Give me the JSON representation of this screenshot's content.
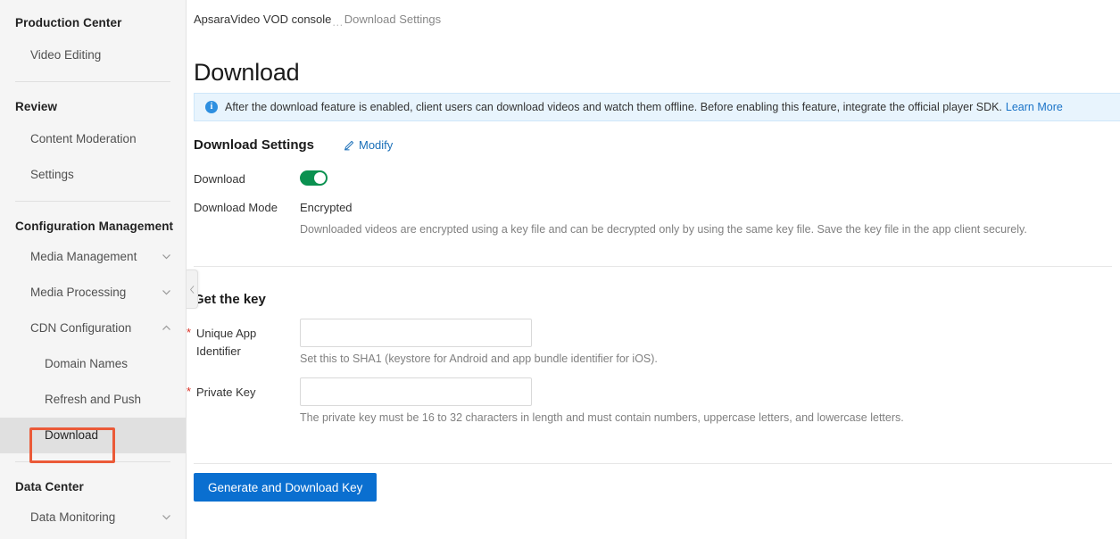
{
  "sidebar": {
    "groups": [
      {
        "title": "Production Center",
        "items": [
          {
            "label": "Video Editing",
            "expandable": false,
            "active": false
          }
        ]
      },
      {
        "title": "Review",
        "items": [
          {
            "label": "Content Moderation",
            "expandable": false,
            "active": false
          },
          {
            "label": "Settings",
            "expandable": false,
            "active": false
          }
        ]
      },
      {
        "title": "Configuration Management",
        "items": [
          {
            "label": "Media Management",
            "expandable": true,
            "expanded": false,
            "active": false
          },
          {
            "label": "Media Processing",
            "expandable": true,
            "expanded": false,
            "active": false
          },
          {
            "label": "CDN Configuration",
            "expandable": true,
            "expanded": true,
            "active": false
          },
          {
            "label": "Domain Names",
            "sub": true,
            "expandable": false,
            "active": false
          },
          {
            "label": "Refresh and Push",
            "sub": true,
            "expandable": false,
            "active": false
          },
          {
            "label": "Download",
            "sub": true,
            "expandable": false,
            "active": true
          }
        ]
      },
      {
        "title": "Data Center",
        "items": [
          {
            "label": "Data Monitoring",
            "expandable": true,
            "expanded": false,
            "active": false
          }
        ]
      }
    ],
    "collapse_handle_icon": "chevron-left-icon"
  },
  "breadcrumb": {
    "root": "ApsaraVideo VOD console",
    "separator": "...",
    "current": "Download Settings"
  },
  "page": {
    "title": "Download"
  },
  "banner": {
    "icon": "info-icon",
    "text": "After the download feature is enabled, client users can download videos and watch them offline. Before enabling this feature, integrate the official player SDK.",
    "link_label": "Learn More"
  },
  "download_settings": {
    "header": "Download Settings",
    "modify_label": "Modify",
    "modify_icon": "pencil-icon",
    "download_label": "Download",
    "download_enabled": true,
    "mode_label": "Download Mode",
    "mode_value": "Encrypted",
    "mode_description": "Downloaded videos are encrypted using a key file and can be decrypted only by using the same key file. Save the key file in the app client securely."
  },
  "get_key": {
    "header": "Get the key",
    "fields": [
      {
        "label": "Unique App Identifier",
        "required": true,
        "value": "",
        "placeholder": "",
        "helper": "Set this to SHA1 (keystore for Android and app bundle identifier for iOS)."
      },
      {
        "label": "Private Key",
        "required": true,
        "value": "",
        "placeholder": "",
        "helper": "The private key must be 16 to 32 characters in length and must contain numbers, uppercase letters, and lowercase letters."
      }
    ],
    "submit_label": "Generate and Download Key"
  },
  "colors": {
    "accent_blue": "#0a6fd0",
    "link_blue": "#1a73c8",
    "toggle_green": "#0a9150",
    "required_red": "#d93025",
    "annotation_red": "#eb5a38",
    "banner_bg": "#e8f4fd",
    "sidebar_bg": "#f5f5f5"
  }
}
